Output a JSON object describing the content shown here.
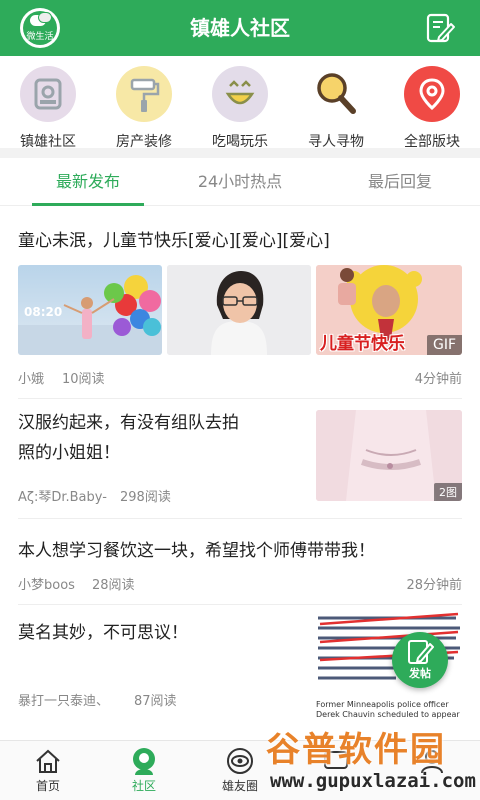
{
  "header": {
    "logo_text": "微生活",
    "title": "镇雄人社区"
  },
  "categories": [
    {
      "label": "镇雄社区",
      "icon": "community-icon",
      "color": "#e6dbe9"
    },
    {
      "label": "房产装修",
      "icon": "roller-brush-icon",
      "color": "#f7e8a6"
    },
    {
      "label": "吃喝玩乐",
      "icon": "smile-face-icon",
      "color": "#e3dce9"
    },
    {
      "label": "寻人寻物",
      "icon": "magnifier-icon",
      "color": "#ffffff"
    },
    {
      "label": "全部版块",
      "icon": "location-pin-icon",
      "color": "#f04a45"
    }
  ],
  "tabs": [
    {
      "label": "最新发布",
      "active": true
    },
    {
      "label": "24小时热点",
      "active": false
    },
    {
      "label": "最后回复",
      "active": false
    }
  ],
  "posts": [
    {
      "title": "童心未泯，儿童节快乐[爱心][爱心][爱心]",
      "author": "小娥",
      "reads": "10阅读",
      "time": "4分钟前",
      "images": [
        {
          "alt": "balloon-photo",
          "overlay_time": "08:20"
        },
        {
          "alt": "selfie-photo"
        },
        {
          "alt": "childrens-day-meme",
          "caption": "儿童节快乐",
          "badge": "GIF"
        }
      ]
    },
    {
      "title_line1": "汉服约起来，有没有组队去拍",
      "title_line2": "照的小姐姐！",
      "author": "Aζ:琴Dr.Baby-",
      "reads": "298阅读",
      "badge": "2图"
    },
    {
      "title": "本人想学习餐饮这一块，希望找个师傅带带我！",
      "author": "小梦boos",
      "reads": "28阅读",
      "time": "28分钟前"
    },
    {
      "title": "莫名其妙，不可思议！",
      "author": "暴打一只泰迪、",
      "reads": "87阅读",
      "news_caption": "Former Minneapolis police officer Derek Chauvin scheduled to appear in court Monday"
    }
  ],
  "post_button": {
    "label": "发帖"
  },
  "bottom_nav": [
    {
      "label": "首页",
      "icon": "home-icon",
      "active": false
    },
    {
      "label": "社区",
      "icon": "community-nav-icon",
      "active": true
    },
    {
      "label": "雄友圈",
      "icon": "eye-circle-icon",
      "active": false
    },
    {
      "label": "",
      "icon": "message-icon",
      "active": false
    },
    {
      "label": "",
      "icon": "profile-icon",
      "active": false
    }
  ],
  "watermark": {
    "cn": "谷普软件园",
    "en": "www.gupuxlazai.com"
  },
  "colors": {
    "brand_green": "#2eab5a"
  }
}
